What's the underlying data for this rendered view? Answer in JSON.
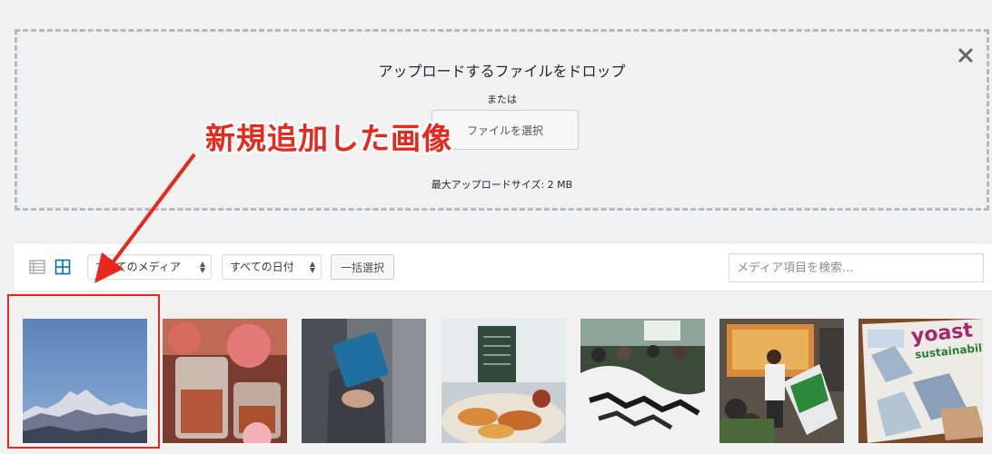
{
  "uploader": {
    "title": "アップロードするファイルをドロップ",
    "or": "または",
    "select_button": "ファイルを選択",
    "max_size": "最大アップロードサイズ: 2 MB"
  },
  "toolbar": {
    "type_filter": "すべてのメディア",
    "date_filter": "すべての日付",
    "bulk_select": "一括選択",
    "search_placeholder": "メディア項目を検索..."
  },
  "annotation": {
    "label": "新規追加した画像",
    "color": "#e8281c"
  },
  "media_items": [
    {
      "name": "mountain-landscape",
      "selected": true
    },
    {
      "name": "glasses-and-snacks"
    },
    {
      "name": "person-with-blue-notebook"
    },
    {
      "name": "food-platter-menu-board"
    },
    {
      "name": "conference-audience"
    },
    {
      "name": "speaker-at-conference"
    },
    {
      "name": "yoast-sustainability-paper"
    }
  ],
  "colors": {
    "accent": "#0073aa",
    "background": "#f1f1f1"
  }
}
